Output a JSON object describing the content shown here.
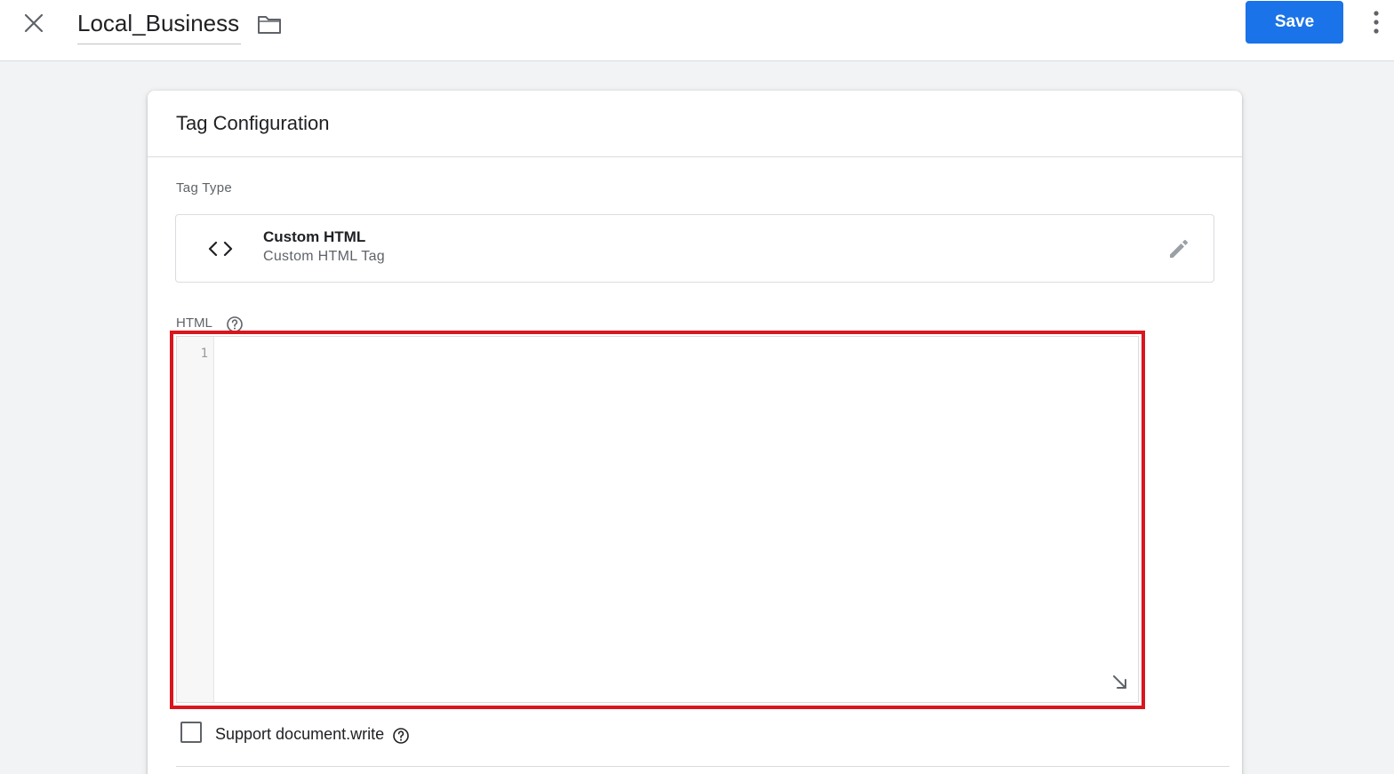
{
  "header": {
    "tag_name": "Local_Business",
    "save_label": "Save",
    "icons": {
      "close": "close-icon",
      "folder": "folder-icon",
      "more": "more-vert-icon"
    }
  },
  "card": {
    "title": "Tag Configuration",
    "tag_type": {
      "label": "Tag Type",
      "name": "Custom HTML",
      "subtitle": "Custom HTML Tag",
      "icons": {
        "type": "code-brackets-icon",
        "edit": "pencil-icon"
      }
    },
    "html": {
      "label": "HTML",
      "line_numbers": [
        "1"
      ],
      "value": ""
    },
    "support_document_write": {
      "label": "Support document.write",
      "checked": false
    }
  },
  "colors": {
    "accent": "#1a73e8",
    "highlight": "#d9151e",
    "background": "#f1f3f4"
  }
}
